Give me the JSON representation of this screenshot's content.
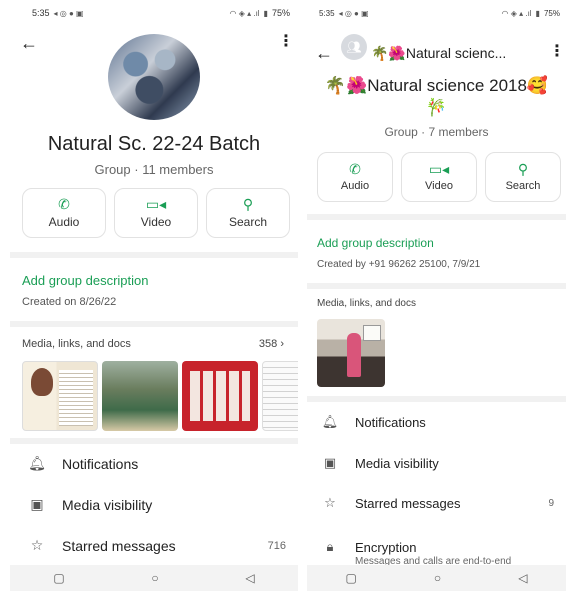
{
  "left": {
    "status": {
      "time": "5:35",
      "battery": "75%"
    },
    "group_name": "Natural Sc. 22-24 Batch",
    "group_meta": "Group · 11 members",
    "actions": {
      "audio": "Audio",
      "video": "Video",
      "search": "Search"
    },
    "add_description": "Add group description",
    "created": "Created on 8/26/22",
    "media": {
      "label": "Media, links, and docs",
      "count": "358"
    },
    "list": {
      "notifications": "Notifications",
      "media_visibility": "Media visibility",
      "starred": "Starred messages",
      "starred_count": "716"
    }
  },
  "right": {
    "status": {
      "time": "5:35",
      "battery": "75%"
    },
    "header_title": "🌴🌺Natural scienc...",
    "title_line1": "🌴🌺Natural science 2018🥰",
    "title_line2": "🎋",
    "group_meta": "Group · 7 members",
    "actions": {
      "audio": "Audio",
      "video": "Video",
      "search": "Search"
    },
    "add_description": "Add group description",
    "created": "Created by +91 96262 25100, 7/9/21",
    "media": {
      "label": "Media, links, and docs"
    },
    "list": {
      "notifications": "Notifications",
      "media_visibility": "Media visibility",
      "starred": "Starred messages",
      "starred_count": "9",
      "encryption": "Encryption",
      "encryption_sub": "Messages and calls are end-to-end"
    }
  },
  "icons": {
    "back": "arrow-left-icon",
    "more": "kebab-menu-icon",
    "audio": "phone-icon",
    "video": "video-camera-icon",
    "search": "search-icon",
    "notifications": "bell-icon",
    "media_visibility": "image-icon",
    "starred": "star-icon",
    "encryption": "lock-icon"
  },
  "colors": {
    "accent": "#1a9e55",
    "divider": "#f1f1f1"
  }
}
